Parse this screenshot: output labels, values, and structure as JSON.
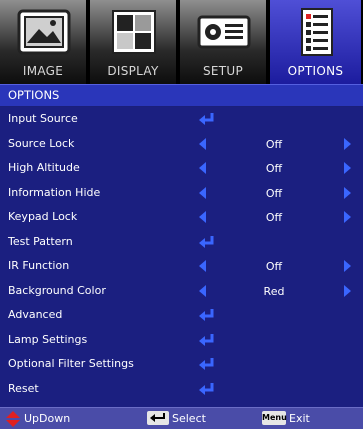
{
  "tabs": [
    {
      "label": "IMAGE",
      "icon": "image-icon"
    },
    {
      "label": "DISPLAY",
      "icon": "display-icon"
    },
    {
      "label": "SETUP",
      "icon": "projector-icon"
    },
    {
      "label": "OPTIONS",
      "icon": "options-icon"
    }
  ],
  "active_tab": "OPTIONS",
  "header_title": "OPTIONS",
  "menu": {
    "items": [
      {
        "label": "Input Source",
        "type": "enter"
      },
      {
        "label": "Source Lock",
        "type": "select",
        "value": "Off"
      },
      {
        "label": "High Altitude",
        "type": "select",
        "value": "Off"
      },
      {
        "label": "Information Hide",
        "type": "select",
        "value": "Off"
      },
      {
        "label": "Keypad Lock",
        "type": "select",
        "value": "Off"
      },
      {
        "label": "Test Pattern",
        "type": "enter"
      },
      {
        "label": "IR Function",
        "type": "select",
        "value": "Off"
      },
      {
        "label": "Background Color",
        "type": "select",
        "value": "Red"
      },
      {
        "label": "Advanced",
        "type": "enter"
      },
      {
        "label": "Lamp Settings",
        "type": "enter"
      },
      {
        "label": "Optional Filter Settings",
        "type": "enter"
      },
      {
        "label": "Reset",
        "type": "enter"
      }
    ]
  },
  "footer": {
    "updown_label": "UpDown",
    "select_label": "Select",
    "menu_key_label": "Menu",
    "exit_label": "Exit"
  },
  "colors": {
    "background": "#1b1f80",
    "header": "#2a36ba",
    "arrow": "#3a66ff",
    "footer": "#4a4ca8",
    "active_tab": "#2b2bb8"
  }
}
